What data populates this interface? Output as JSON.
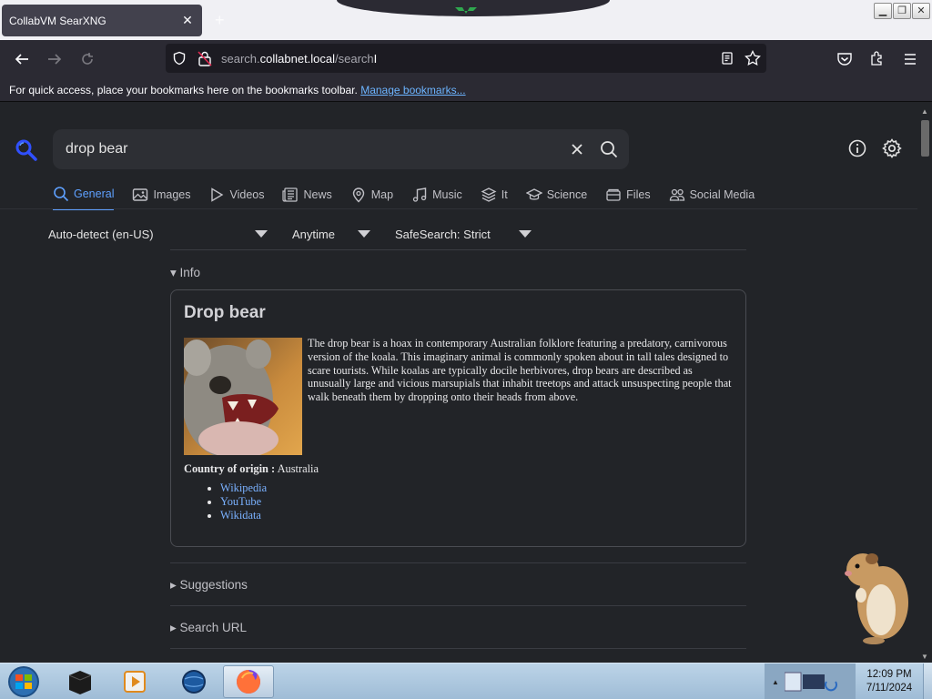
{
  "browser": {
    "tab_title": "CollabVM SearXNG",
    "tab_close": "✕",
    "new_tab": "+",
    "url_prefix": "search.",
    "url_domain": "collabnet.local",
    "url_path": "/search",
    "bookmarks_text": "For quick access, place your bookmarks here on the bookmarks toolbar.",
    "manage_bookmarks": "Manage bookmarks..."
  },
  "search": {
    "query": "drop bear",
    "categories": [
      {
        "label": "General",
        "icon": "search-icon",
        "active": true
      },
      {
        "label": "Images",
        "icon": "image-icon"
      },
      {
        "label": "Videos",
        "icon": "play-icon"
      },
      {
        "label": "News",
        "icon": "newspaper-icon"
      },
      {
        "label": "Map",
        "icon": "map-pin-icon"
      },
      {
        "label": "Music",
        "icon": "music-icon"
      },
      {
        "label": "It",
        "icon": "layers-icon"
      },
      {
        "label": "Science",
        "icon": "school-icon"
      },
      {
        "label": "Files",
        "icon": "files-icon"
      },
      {
        "label": "Social Media",
        "icon": "people-icon"
      }
    ],
    "filters": {
      "language": "Auto-detect (en-US)",
      "time": "Anytime",
      "safesearch": "SafeSearch: Strict"
    }
  },
  "infobox": {
    "section": "Info",
    "title": "Drop bear",
    "description": "The drop bear is a hoax in contemporary Australian folklore featuring a predatory, carnivorous version of the koala. This imaginary animal is commonly spoken about in tall tales designed to scare tourists. While koalas are typically docile herbivores, drop bears are described as unusually large and vicious marsupials that inhabit treetops and attack unsuspecting people that walk beneath them by dropping onto their heads from above.",
    "attr_label": "Country of origin :",
    "attr_value": "Australia",
    "links": [
      "Wikipedia",
      "YouTube",
      "Wikidata"
    ]
  },
  "sections": {
    "suggestions": "Suggestions",
    "search_url": "Search URL"
  },
  "taskbar": {
    "time": "12:09 PM",
    "date": "7/11/2024"
  },
  "colors": {
    "accent": "#5ea0ff",
    "background": "#222428"
  }
}
